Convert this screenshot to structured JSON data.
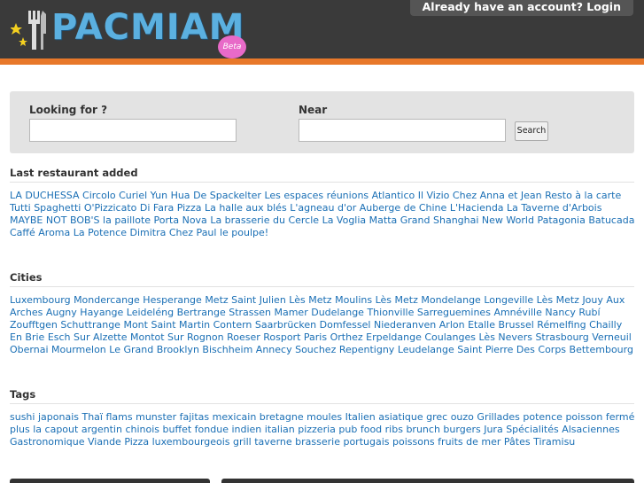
{
  "header": {
    "logo_text": "PACMIAM",
    "beta_label": "Beta",
    "login_label": "Already have an account? Login"
  },
  "search": {
    "looking_for_label": "Looking for ?",
    "near_label": "Near",
    "looking_for_value": "",
    "near_value": "",
    "button_label": "Search"
  },
  "last_restaurants": {
    "title": "Last restaurant added",
    "items": [
      "LA DUCHESSA",
      "Circolo Curiel",
      "Yun Hua",
      "De Spackelter",
      "Les espaces réunions",
      "Atlantico",
      "Il Vizio",
      "Chez Anna et Jean",
      "Resto à la carte",
      "Tutti Spaghetti",
      "O'Pizzicato",
      "Di Fara Pizza",
      "La halle aux blés",
      "L'agneau d'or",
      "Auberge de Chine",
      "L'Hacienda",
      "La Taverne d'Arbois",
      "MAYBE NOT BOB'S",
      "la paillote",
      "Porta Nova",
      "La brasserie du Cercle",
      "La Voglia Matta",
      "Grand Shanghai",
      "New World",
      "Patagonia",
      "Batucada",
      "Caffé Aroma",
      "La Potence",
      "Dimitra",
      "Chez Paul",
      "le poulpe!"
    ]
  },
  "cities": {
    "title": "Cities",
    "items": [
      "Luxembourg",
      "Mondercange",
      "Hesperange",
      "Metz",
      "Saint Julien Lès Metz",
      "Moulins Lès Metz",
      "Mondelange",
      "Longeville Lès Metz",
      "Jouy Aux Arches",
      "Augny",
      "Hayange",
      "Leideléng",
      "Bertrange",
      "Strassen",
      "Mamer",
      "Dudelange",
      "Thionville",
      "Sarreguemines",
      "Amnéville",
      "Nancy",
      "Rubí",
      "Zoufftgen",
      "Schuttrange",
      "Mont Saint Martin",
      "Contern",
      "Saarbrücken",
      "Domfessel",
      "Niederanven",
      "Arlon",
      "Etalle",
      "Brussel",
      "Rémelfing",
      "Chailly En Brie",
      "Esch Sur Alzette",
      "Montot Sur Rognon",
      "Roeser",
      "Rosport",
      "Paris",
      "Orthez",
      "Erpeldange",
      "Coulanges Lès Nevers",
      "Strasbourg",
      "Verneuil",
      "Obernai",
      "Mourmelon Le Grand",
      "Brooklyn",
      "Bischheim",
      "Annecy",
      "Souchez",
      "Repentigny",
      "Leudelange",
      "Saint Pierre Des Corps",
      "Bettembourg"
    ]
  },
  "tags": {
    "title": "Tags",
    "items": [
      "sushi",
      "japonais",
      "Thaï",
      "flams",
      "munster",
      "fajitas",
      "mexicain",
      "bretagne",
      "moules",
      "Italien",
      "asiatique",
      "grec",
      "ouzo",
      "Grillades",
      "potence",
      "poisson",
      "fermé",
      "plus la capout",
      "argentin",
      "chinois",
      "buffet",
      "fondue",
      "indien",
      "italian",
      "pizzeria",
      "pub food",
      "ribs",
      "brunch",
      "burgers",
      "Jura",
      "Spécialités Alsaciennes",
      "Gastronomique",
      "Viande",
      "Pizza",
      "luxembourgeois",
      "grill",
      "taverne",
      "brasserie",
      "portugais",
      "poissons",
      "fruits de mer",
      "Pâtes",
      "Tiramisu"
    ]
  },
  "colors": {
    "header_bg": "#3a3a3a",
    "accent_orange": "#e8782a",
    "link_blue": "#1a6fb5",
    "logo_blue": "#5bb0e0",
    "beta_pink": "#e86ac8"
  }
}
